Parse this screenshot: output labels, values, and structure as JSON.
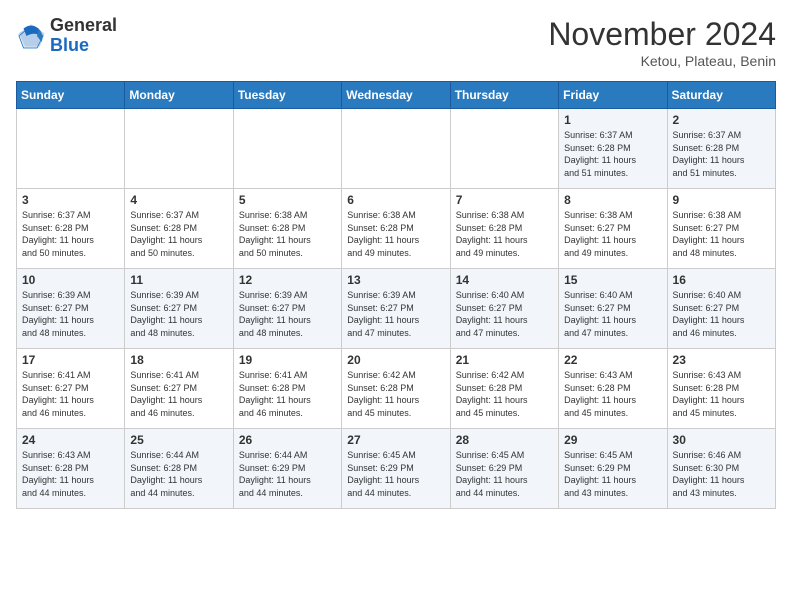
{
  "logo": {
    "general": "General",
    "blue": "Blue"
  },
  "title": "November 2024",
  "location": "Ketou, Plateau, Benin",
  "days_of_week": [
    "Sunday",
    "Monday",
    "Tuesday",
    "Wednesday",
    "Thursday",
    "Friday",
    "Saturday"
  ],
  "weeks": [
    [
      {
        "day": "",
        "info": ""
      },
      {
        "day": "",
        "info": ""
      },
      {
        "day": "",
        "info": ""
      },
      {
        "day": "",
        "info": ""
      },
      {
        "day": "",
        "info": ""
      },
      {
        "day": "1",
        "info": "Sunrise: 6:37 AM\nSunset: 6:28 PM\nDaylight: 11 hours\nand 51 minutes."
      },
      {
        "day": "2",
        "info": "Sunrise: 6:37 AM\nSunset: 6:28 PM\nDaylight: 11 hours\nand 51 minutes."
      }
    ],
    [
      {
        "day": "3",
        "info": "Sunrise: 6:37 AM\nSunset: 6:28 PM\nDaylight: 11 hours\nand 50 minutes."
      },
      {
        "day": "4",
        "info": "Sunrise: 6:37 AM\nSunset: 6:28 PM\nDaylight: 11 hours\nand 50 minutes."
      },
      {
        "day": "5",
        "info": "Sunrise: 6:38 AM\nSunset: 6:28 PM\nDaylight: 11 hours\nand 50 minutes."
      },
      {
        "day": "6",
        "info": "Sunrise: 6:38 AM\nSunset: 6:28 PM\nDaylight: 11 hours\nand 49 minutes."
      },
      {
        "day": "7",
        "info": "Sunrise: 6:38 AM\nSunset: 6:28 PM\nDaylight: 11 hours\nand 49 minutes."
      },
      {
        "day": "8",
        "info": "Sunrise: 6:38 AM\nSunset: 6:27 PM\nDaylight: 11 hours\nand 49 minutes."
      },
      {
        "day": "9",
        "info": "Sunrise: 6:38 AM\nSunset: 6:27 PM\nDaylight: 11 hours\nand 48 minutes."
      }
    ],
    [
      {
        "day": "10",
        "info": "Sunrise: 6:39 AM\nSunset: 6:27 PM\nDaylight: 11 hours\nand 48 minutes."
      },
      {
        "day": "11",
        "info": "Sunrise: 6:39 AM\nSunset: 6:27 PM\nDaylight: 11 hours\nand 48 minutes."
      },
      {
        "day": "12",
        "info": "Sunrise: 6:39 AM\nSunset: 6:27 PM\nDaylight: 11 hours\nand 48 minutes."
      },
      {
        "day": "13",
        "info": "Sunrise: 6:39 AM\nSunset: 6:27 PM\nDaylight: 11 hours\nand 47 minutes."
      },
      {
        "day": "14",
        "info": "Sunrise: 6:40 AM\nSunset: 6:27 PM\nDaylight: 11 hours\nand 47 minutes."
      },
      {
        "day": "15",
        "info": "Sunrise: 6:40 AM\nSunset: 6:27 PM\nDaylight: 11 hours\nand 47 minutes."
      },
      {
        "day": "16",
        "info": "Sunrise: 6:40 AM\nSunset: 6:27 PM\nDaylight: 11 hours\nand 46 minutes."
      }
    ],
    [
      {
        "day": "17",
        "info": "Sunrise: 6:41 AM\nSunset: 6:27 PM\nDaylight: 11 hours\nand 46 minutes."
      },
      {
        "day": "18",
        "info": "Sunrise: 6:41 AM\nSunset: 6:27 PM\nDaylight: 11 hours\nand 46 minutes."
      },
      {
        "day": "19",
        "info": "Sunrise: 6:41 AM\nSunset: 6:28 PM\nDaylight: 11 hours\nand 46 minutes."
      },
      {
        "day": "20",
        "info": "Sunrise: 6:42 AM\nSunset: 6:28 PM\nDaylight: 11 hours\nand 45 minutes."
      },
      {
        "day": "21",
        "info": "Sunrise: 6:42 AM\nSunset: 6:28 PM\nDaylight: 11 hours\nand 45 minutes."
      },
      {
        "day": "22",
        "info": "Sunrise: 6:43 AM\nSunset: 6:28 PM\nDaylight: 11 hours\nand 45 minutes."
      },
      {
        "day": "23",
        "info": "Sunrise: 6:43 AM\nSunset: 6:28 PM\nDaylight: 11 hours\nand 45 minutes."
      }
    ],
    [
      {
        "day": "24",
        "info": "Sunrise: 6:43 AM\nSunset: 6:28 PM\nDaylight: 11 hours\nand 44 minutes."
      },
      {
        "day": "25",
        "info": "Sunrise: 6:44 AM\nSunset: 6:28 PM\nDaylight: 11 hours\nand 44 minutes."
      },
      {
        "day": "26",
        "info": "Sunrise: 6:44 AM\nSunset: 6:29 PM\nDaylight: 11 hours\nand 44 minutes."
      },
      {
        "day": "27",
        "info": "Sunrise: 6:45 AM\nSunset: 6:29 PM\nDaylight: 11 hours\nand 44 minutes."
      },
      {
        "day": "28",
        "info": "Sunrise: 6:45 AM\nSunset: 6:29 PM\nDaylight: 11 hours\nand 44 minutes."
      },
      {
        "day": "29",
        "info": "Sunrise: 6:45 AM\nSunset: 6:29 PM\nDaylight: 11 hours\nand 43 minutes."
      },
      {
        "day": "30",
        "info": "Sunrise: 6:46 AM\nSunset: 6:30 PM\nDaylight: 11 hours\nand 43 minutes."
      }
    ]
  ]
}
